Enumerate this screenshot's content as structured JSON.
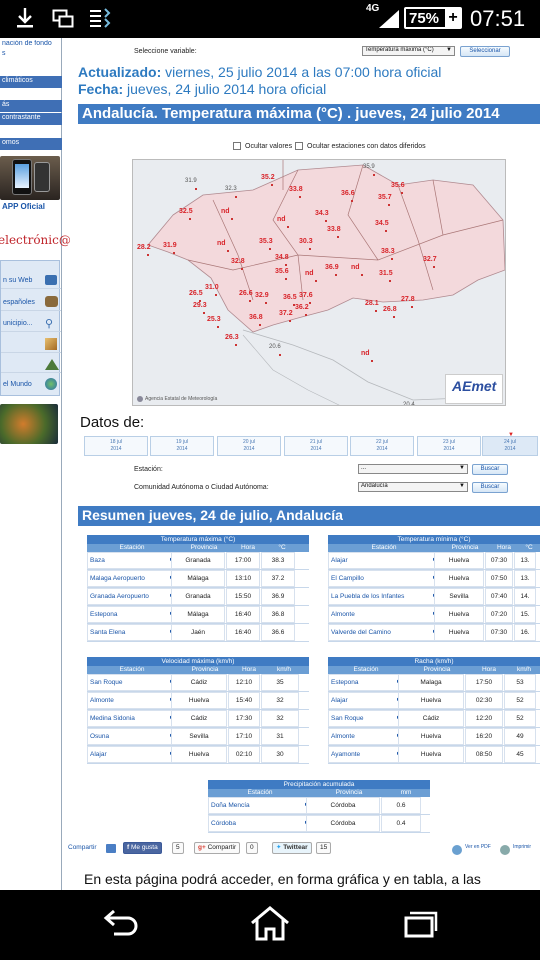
{
  "status_bar": {
    "network": "4G",
    "battery": "75%",
    "time": "07:51"
  },
  "sidebar": {
    "top_link": "nación de fondo",
    "top_link2": "s",
    "item_climaticos": "climáticos",
    "item_as": "ás",
    "item_contrastante": "contrastante",
    "item_omos": "omos",
    "app_label": "APP  Oficial",
    "electronica": "electrónic@",
    "links": [
      "n su Web",
      "españoles",
      "unicipio...",
      "",
      "",
      "el Mundo"
    ]
  },
  "main": {
    "select_variable_label": "Seleccione variable:",
    "variable_value": "Temperatura máxima (°C)",
    "select_button": "Seleccionar",
    "updated_label": "Actualizado:",
    "updated_value": "viernes, 25 julio 2014 a las 07:00 hora oficial",
    "date_label": "Fecha:",
    "date_value": "jueves, 24 julio 2014 hora oficial",
    "header_title": "Andalucía. Temperatura máxima (°C) . jueves, 24 julio 2014",
    "hide_values": "Ocultar valores",
    "hide_stations": "Ocultar estaciones con datos diferidos",
    "map_credit": "Agencia Estatal de Meteorología",
    "aemet_logo": "AEmet",
    "datos_de": "Datos de:",
    "date_tabs": [
      {
        "day": "18 jul",
        "year": "2014"
      },
      {
        "day": "19 jul",
        "year": "2014"
      },
      {
        "day": "20 jul",
        "year": "2014"
      },
      {
        "day": "21 jul",
        "year": "2014"
      },
      {
        "day": "22 jul",
        "year": "2014"
      },
      {
        "day": "23 jul",
        "year": "2014"
      },
      {
        "day": "24 jul",
        "year": "2014"
      }
    ],
    "station_label": "Estación:",
    "station_value": "...",
    "community_label": "Comunidad Autónoma o Ciudad Autónoma:",
    "community_value": "Andalucía",
    "search_button": "Buscar",
    "resumen_title": "Resumen jueves, 24 de julio, Andalucía",
    "share_label": "Compartir",
    "megusta": "Me gusta",
    "megusta_count": "5",
    "gplus": "Compartir",
    "gplus_count": "0",
    "twittear": "Twittear",
    "tw_count": "15",
    "pdf": "Ver en PDF",
    "print": "Imprimir",
    "intro_text": "En esta página podrá acceder, en forma gráfica y en tabla, a las"
  },
  "map_values": [
    {
      "v": "35.9",
      "g": true
    },
    {
      "v": "31.9",
      "g": true
    },
    {
      "v": "32.3",
      "g": true
    },
    {
      "v": "35.2"
    },
    {
      "v": "33.8"
    },
    {
      "v": "36.6"
    },
    {
      "v": "35.6"
    },
    {
      "v": "35.7"
    },
    {
      "v": "32.5"
    },
    {
      "v": "nd"
    },
    {
      "v": "34.3"
    },
    {
      "v": "nd"
    },
    {
      "v": "33.8"
    },
    {
      "v": "34.5"
    },
    {
      "v": "28.2"
    },
    {
      "v": "31.9"
    },
    {
      "v": "nd"
    },
    {
      "v": "35.3"
    },
    {
      "v": "30.3"
    },
    {
      "v": "38.3"
    },
    {
      "v": "32.7"
    },
    {
      "v": "32.8"
    },
    {
      "v": "34.8"
    },
    {
      "v": "nd"
    },
    {
      "v": "35.6"
    },
    {
      "v": "36.9"
    },
    {
      "v": "nd"
    },
    {
      "v": "31.5"
    },
    {
      "v": "31.0"
    },
    {
      "v": "26.5"
    },
    {
      "v": "26.6"
    },
    {
      "v": "32.9"
    },
    {
      "v": "36.5"
    },
    {
      "v": "37.6"
    },
    {
      "v": "29.3"
    },
    {
      "v": "36.2"
    },
    {
      "v": "28.1"
    },
    {
      "v": "27.8"
    },
    {
      "v": "26.8"
    },
    {
      "v": "25.3"
    },
    {
      "v": "36.8"
    },
    {
      "v": "37.2"
    },
    {
      "v": "26.3"
    },
    {
      "v": "20.6",
      "g": true
    },
    {
      "v": "nd"
    },
    {
      "v": "20.4",
      "g": true
    }
  ],
  "tables": {
    "tmax": {
      "title": "Temperatura máxima (°C)",
      "cols": [
        "Estación",
        "Provincia",
        "Hora",
        "°C"
      ],
      "rows": [
        [
          "Baza",
          "Granada",
          "17:00",
          "38.3"
        ],
        [
          "Malaga Aeropuerto",
          "Málaga",
          "13:10",
          "37.2"
        ],
        [
          "Granada Aeropuerto",
          "Granada",
          "15:50",
          "36.9"
        ],
        [
          "Estepona",
          "Málaga",
          "16:40",
          "36.8"
        ],
        [
          "Santa Elena",
          "Jaén",
          "16:40",
          "36.6"
        ]
      ]
    },
    "tmin": {
      "title": "Temperatura mínima (°C)",
      "cols": [
        "Estación",
        "Provincia",
        "Hora",
        "°C"
      ],
      "rows": [
        [
          "Alajar",
          "Huelva",
          "07:30",
          "13."
        ],
        [
          "El Campillo",
          "Huelva",
          "07:50",
          "13."
        ],
        [
          "La Puebla de los Infantes",
          "Sevilla",
          "07:40",
          "14."
        ],
        [
          "Almonte",
          "Huelva",
          "07:20",
          "15."
        ],
        [
          "Valverde del Camino",
          "Huelva",
          "07:30",
          "16."
        ]
      ]
    },
    "vmax": {
      "title": "Velocidad máxima (km/h)",
      "cols": [
        "Estación",
        "Provincia",
        "Hora",
        "km/h"
      ],
      "rows": [
        [
          "San Roque",
          "Cádiz",
          "12:10",
          "35"
        ],
        [
          "Almonte",
          "Huelva",
          "15:40",
          "32"
        ],
        [
          "Medina Sidonia",
          "Cádiz",
          "17:30",
          "32"
        ],
        [
          "Osuna",
          "Sevilla",
          "17:10",
          "31"
        ],
        [
          "Alajar",
          "Huelva",
          "02:10",
          "30"
        ]
      ]
    },
    "racha": {
      "title": "Racha (km/h)",
      "cols": [
        "Estación",
        "Provincia",
        "Hora",
        "km/h"
      ],
      "rows": [
        [
          "Estepona",
          "Malaga",
          "17:50",
          "53"
        ],
        [
          "Alajar",
          "Huelva",
          "02:30",
          "52"
        ],
        [
          "San Roque",
          "Cádiz",
          "12:20",
          "52"
        ],
        [
          "Almonte",
          "Huelva",
          "16:20",
          "49"
        ],
        [
          "Ayamonte",
          "Huelva",
          "08:50",
          "45"
        ]
      ]
    },
    "precip": {
      "title": "Precipitación acumulada",
      "cols": [
        "Estación",
        "Provincia",
        "mm"
      ],
      "rows": [
        [
          "Doña Mencía",
          "Córdoba",
          "0.6"
        ],
        [
          "Córdoba",
          "Córdoba",
          "0.4"
        ]
      ]
    }
  }
}
